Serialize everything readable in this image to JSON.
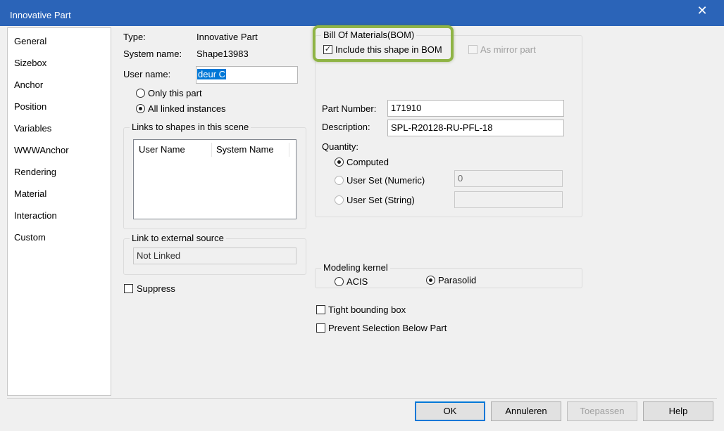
{
  "window": {
    "title": "Innovative Part",
    "close_icon": "close-icon"
  },
  "nav": {
    "items": [
      "General",
      "Sizebox",
      "Anchor",
      "Position",
      "Variables",
      "WWWAnchor",
      "Rendering",
      "Material",
      "Interaction",
      "Custom"
    ]
  },
  "general": {
    "type_label": "Type:",
    "type_value": "Innovative Part",
    "system_name_label": "System name:",
    "system_name_value": "Shape13983",
    "user_name_label": "User name:",
    "user_name_value": "deur C",
    "scope_options": [
      "Only this part",
      "All linked instances"
    ],
    "scope_selected": "All linked instances",
    "links_group_title": "Links to shapes in this scene",
    "links_columns": [
      "User Name",
      "System Name"
    ],
    "external_group_title": "Link to external source",
    "external_value": "Not Linked",
    "suppress_label": "Suppress"
  },
  "bom": {
    "group_title": "Bill Of Materials(BOM)",
    "include_label": "Include this shape in BOM",
    "include_checked": true,
    "mirror_label": "As mirror part",
    "part_number_label": "Part Number:",
    "part_number_value": "171910",
    "description_label": "Description:",
    "description_value": "SPL-R20128-RU-PFL-18",
    "quantity_label": "Quantity:",
    "quantity_options": [
      "Computed",
      "User Set (Numeric)",
      "User Set (String)"
    ],
    "quantity_selected": "Computed",
    "numeric_value": "0",
    "string_value": ""
  },
  "kernel": {
    "group_title": "Modeling kernel",
    "options": [
      "ACIS",
      "Parasolid"
    ],
    "selected": "Parasolid"
  },
  "options": {
    "tight_bounding_box": "Tight bounding box",
    "prevent_selection": "Prevent Selection Below Part"
  },
  "buttons": {
    "ok": "OK",
    "cancel": "Annuleren",
    "apply": "Toepassen",
    "help": "Help"
  },
  "colors": {
    "titlebar": "#2b64b8",
    "highlight": "#8fb445",
    "selection": "#0078d7"
  }
}
